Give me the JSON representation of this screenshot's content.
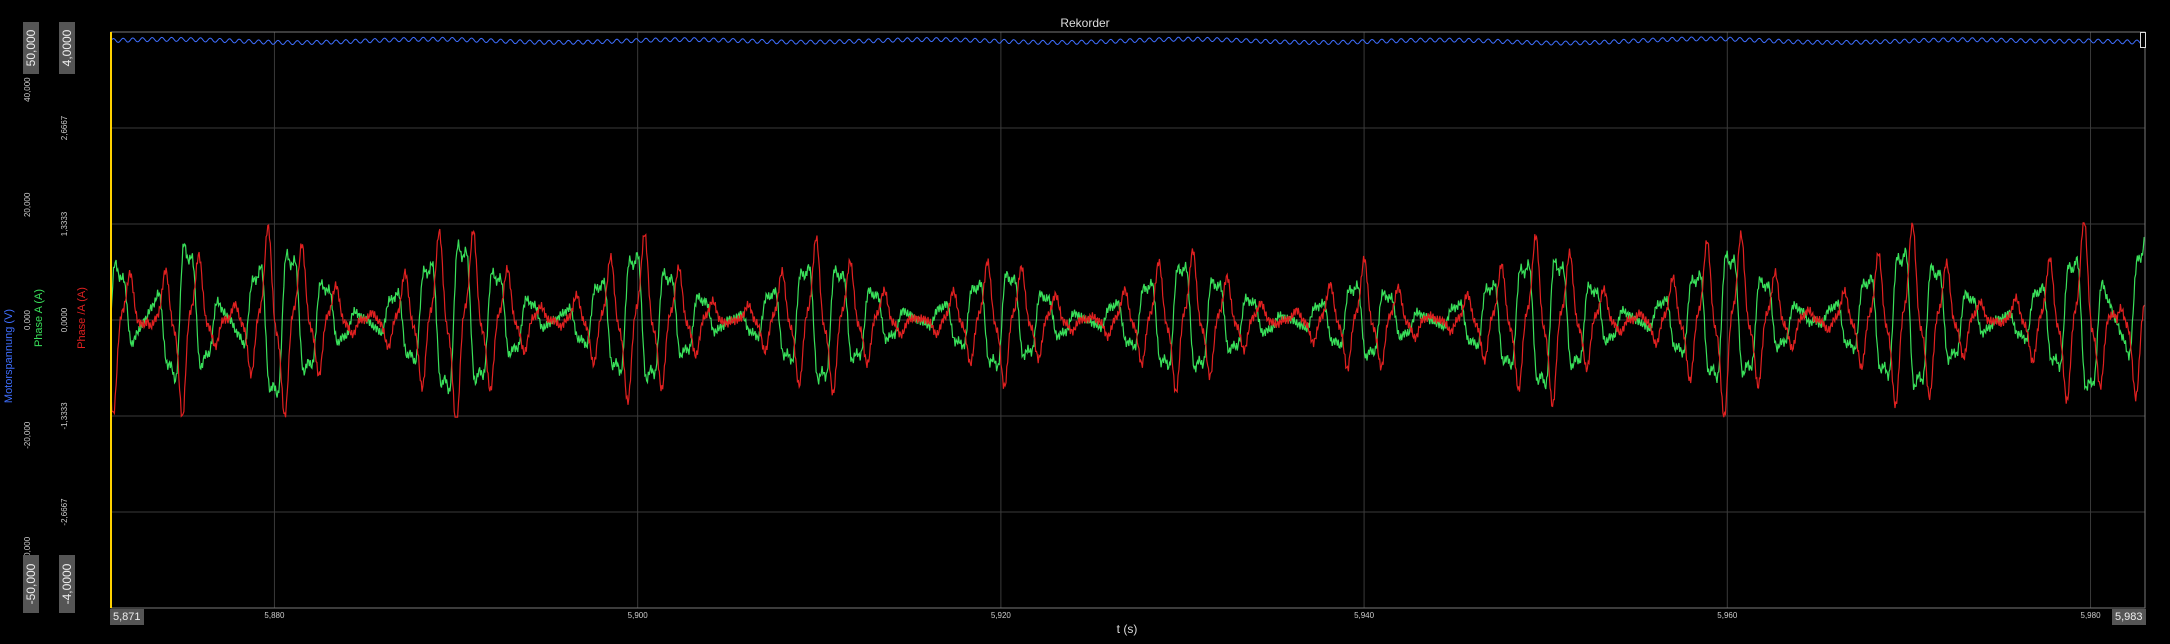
{
  "window": {
    "title": "Rekorder"
  },
  "chart_data": {
    "type": "line",
    "title": "Rekorder",
    "xlabel": "t (s)",
    "xlim": [
      5.871,
      5.983
    ],
    "x_ticks": [
      "5,880",
      "5,900",
      "5,920",
      "5,940",
      "5,960",
      "5,980"
    ],
    "x_tick_values": [
      5.88,
      5.9,
      5.92,
      5.94,
      5.96,
      5.98
    ],
    "x_range_labels": {
      "min": "5,871",
      "max": "5,983"
    },
    "axes": [
      {
        "label": "Motorspannung (V)",
        "color": "#3f6fff",
        "ylim": [
          -50,
          50
        ],
        "ticks": [
          "40,000",
          "20,000",
          "0,000",
          "-20,000",
          "-40,000"
        ],
        "range_labels": {
          "max": "50,000",
          "min": "-50,000"
        }
      },
      {
        "label": "Phase A (A)",
        "color": "#39e05a",
        "ylim": [
          -4,
          4
        ],
        "ticks": [
          "2,6667",
          "1,3333",
          "0,0000",
          "-1,3333",
          "-2,6667"
        ],
        "range_labels": {
          "max": "4,0000",
          "min": "-4,0000"
        }
      },
      {
        "label": "Phase /A (A)",
        "color": "#e02020",
        "ylim": [
          -4,
          4
        ],
        "ticks": [],
        "range_labels": {}
      }
    ],
    "series": [
      {
        "name": "Motorspannung (V)",
        "color": "#3f6fff",
        "axis": 0,
        "x": [
          5.871,
          5.88,
          5.89,
          5.9,
          5.91,
          5.92,
          5.93,
          5.94,
          5.95,
          5.96,
          5.97,
          5.98,
          5.983
        ],
        "y": [
          48.5,
          48.4,
          48.5,
          48.4,
          48.5,
          48.4,
          48.5,
          48.4,
          48.3,
          48.6,
          48.3,
          48.7,
          48.2
        ]
      },
      {
        "name": "Phase A (A)",
        "color": "#39e05a",
        "axis": 1,
        "x": [
          5.871,
          5.875,
          5.88,
          5.89,
          5.9,
          5.91,
          5.92,
          5.93,
          5.94,
          5.95,
          5.96,
          5.97,
          5.98,
          5.983
        ],
        "y": [
          -1.2,
          1.4,
          -1.4,
          1.4,
          -1.2,
          1.1,
          -0.9,
          1.0,
          -0.7,
          1.2,
          -1.2,
          1.3,
          -1.3,
          1.5
        ]
      },
      {
        "name": "Phase /A (A)",
        "color": "#e02020",
        "axis": 2,
        "x": [
          5.871,
          5.875,
          5.88,
          5.89,
          5.9,
          5.91,
          5.92,
          5.93,
          5.94,
          5.95,
          5.96,
          5.97,
          5.98,
          5.983
        ],
        "y": [
          1.3,
          -1.3,
          1.4,
          -1.4,
          1.2,
          -1.1,
          0.9,
          -1.0,
          0.8,
          -1.2,
          1.3,
          -1.3,
          1.4,
          -1.5
        ]
      }
    ],
    "grid": true,
    "legend": "none"
  }
}
